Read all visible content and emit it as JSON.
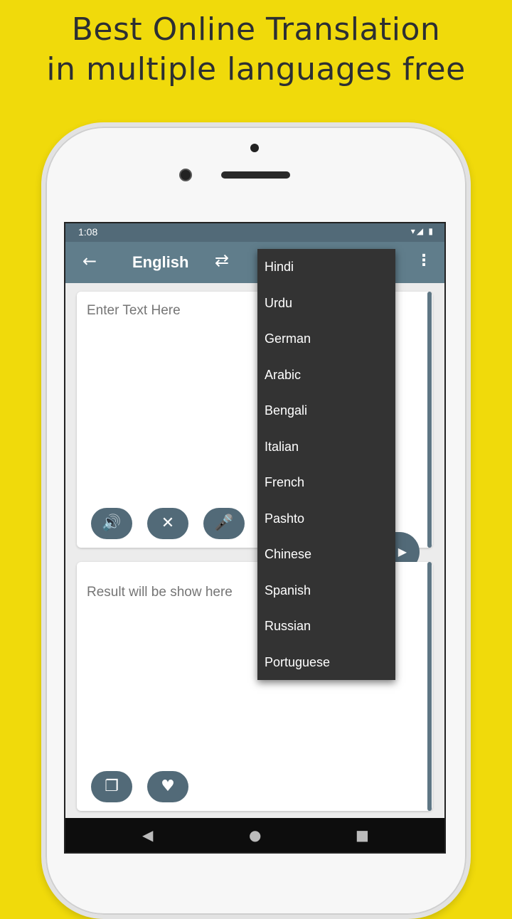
{
  "headline": {
    "line1": "Best Online Translation",
    "line2": "in multiple languages free"
  },
  "status_bar": {
    "time": "1:08",
    "icons": "▾◢ ▮"
  },
  "app_bar": {
    "back_icon": "arrow-left",
    "source_language": "English",
    "swap_icon": "swap-arrows",
    "menu_icon": "more-vertical"
  },
  "input_card": {
    "placeholder": "Enter Text Here",
    "buttons": [
      "speaker",
      "clear",
      "microphone"
    ]
  },
  "output_card": {
    "placeholder": "Result will be show here",
    "buttons": [
      "copy",
      "favorite"
    ]
  },
  "dropdown": {
    "items": [
      "Hindi",
      "Urdu",
      "German",
      "Arabic",
      "Bengali",
      "Italian",
      "French",
      "Pashto",
      "Chinese",
      "Spanish",
      "Russian",
      "Portuguese"
    ]
  },
  "colors": {
    "background": "#f0da0b",
    "app_bar": "#607d8b",
    "status_bar": "#526a78",
    "dropdown": "#333333"
  }
}
